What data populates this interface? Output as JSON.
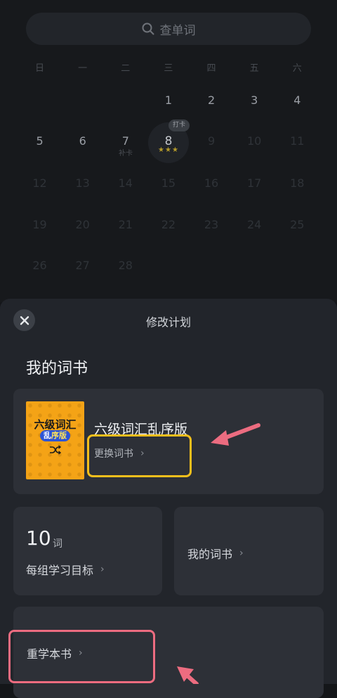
{
  "search": {
    "placeholder": "查单词"
  },
  "calendar": {
    "weekdays": [
      "日",
      "一",
      "二",
      "三",
      "四",
      "五",
      "六"
    ],
    "weeks": [
      [
        "",
        "",
        "",
        "1",
        "2",
        "3",
        "4"
      ],
      [
        "5",
        "6",
        "7",
        "",
        "9",
        "10",
        "11"
      ],
      [
        "12",
        "13",
        "14",
        "15",
        "16",
        "17",
        "18"
      ],
      [
        "19",
        "20",
        "21",
        "22",
        "23",
        "24",
        "25"
      ],
      [
        "26",
        "27",
        "28",
        "",
        "",
        "",
        ""
      ]
    ],
    "today": {
      "day": "8",
      "tag": "打卡",
      "stars": "★★★"
    },
    "makeup_tag": "补卡"
  },
  "sheet": {
    "title": "修改计划",
    "section_title": "我的词书",
    "book": {
      "cover_title": "六级词汇",
      "cover_badge_a": "乱",
      "cover_badge_b": "序版",
      "name": "六级词汇乱序版",
      "change_label": "更换词书"
    },
    "goal": {
      "value": "10",
      "unit": "词",
      "label": "每组学习目标"
    },
    "my_books_label": "我的词书",
    "relearn_label": "重学本书",
    "chevron": "›"
  },
  "colors": {
    "highlight_yellow": "#f4bf1c",
    "highlight_pink": "#ec6c80",
    "cover_orange": "#f4a316"
  }
}
